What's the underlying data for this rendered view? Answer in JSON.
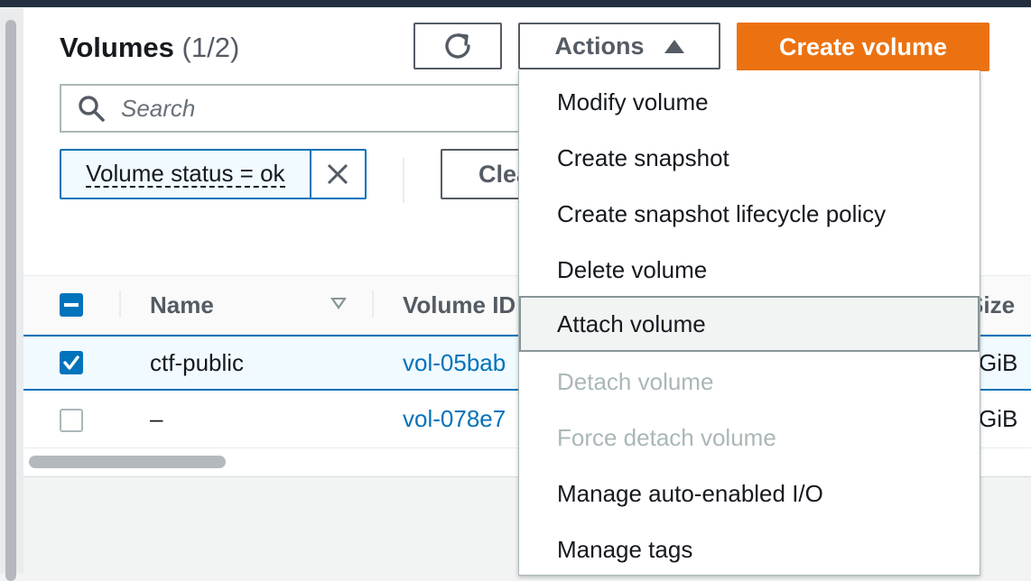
{
  "header": {
    "title": "Volumes",
    "count": "(1/2)",
    "actions_label": "Actions",
    "create_label": "Create volume"
  },
  "search": {
    "placeholder": "Search"
  },
  "filter": {
    "token_label": "Volume status = ok",
    "clear_label": "Clear filters"
  },
  "table": {
    "columns": [
      "Name",
      "Volume ID",
      "Size"
    ],
    "rows": [
      {
        "name": "ctf-public",
        "volume_id": "vol-05bab",
        "size": "GiB",
        "selected": true
      },
      {
        "name": "–",
        "volume_id": "vol-078e7",
        "size": "GiB",
        "selected": false
      }
    ]
  },
  "actions_menu": {
    "items": [
      {
        "label": "Modify volume",
        "enabled": true
      },
      {
        "label": "Create snapshot",
        "enabled": true
      },
      {
        "label": "Create snapshot lifecycle policy",
        "enabled": true
      },
      {
        "label": "Delete volume",
        "enabled": true
      },
      {
        "label": "Attach volume",
        "enabled": true,
        "hovered": true
      },
      {
        "label": "Detach volume",
        "enabled": false
      },
      {
        "label": "Force detach volume",
        "enabled": false
      },
      {
        "label": "Manage auto-enabled I/O",
        "enabled": true
      },
      {
        "label": "Manage tags",
        "enabled": true
      }
    ]
  },
  "colors": {
    "accent": "#0073bb",
    "primary_button": "#ec7211",
    "disabled_text": "#aab7b8"
  },
  "icons": [
    "refresh-icon",
    "caret-up-icon",
    "search-icon",
    "close-icon",
    "sort-icon",
    "checkbox-icon"
  ]
}
